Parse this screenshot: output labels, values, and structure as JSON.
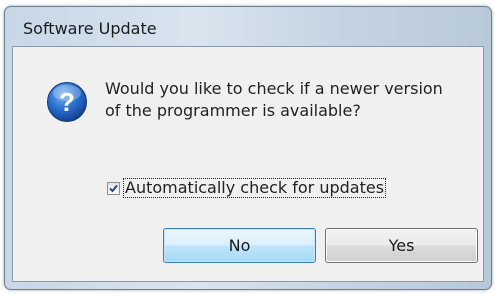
{
  "window": {
    "title": "Software Update"
  },
  "dialog": {
    "icon": "question-icon",
    "message_line1": "Would you like to check if a newer version",
    "message_line2": "of the programmer is available?",
    "checkbox": {
      "label": "Automatically check for updates",
      "checked": true
    },
    "buttons": {
      "no_label": "No",
      "yes_label": "Yes"
    }
  },
  "colors": {
    "titlebar": "#c7d7e6",
    "client_background": "#f0f0f0",
    "icon_blue": "#1c5fb8",
    "default_button_border": "#3c7fb1"
  }
}
